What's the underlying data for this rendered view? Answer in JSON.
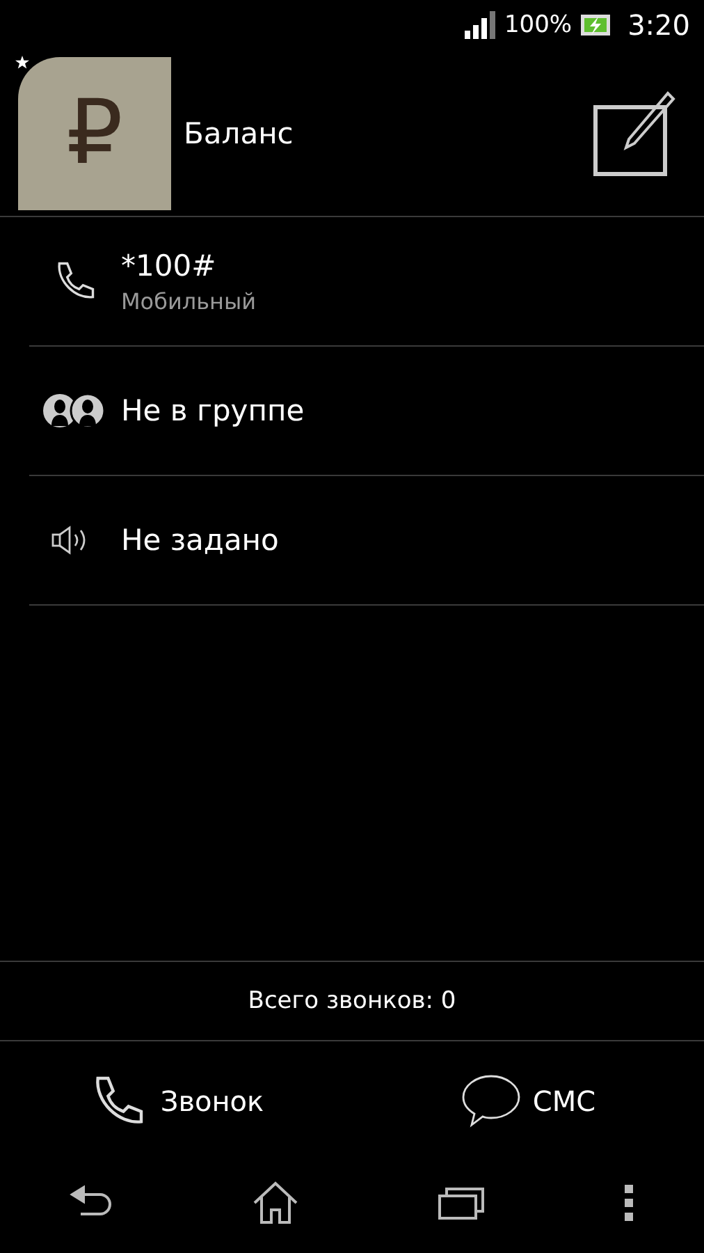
{
  "status_bar": {
    "battery": "100%",
    "time": "3:20"
  },
  "contact": {
    "avatar_symbol": "₽",
    "favorite": true,
    "name": "Баланс"
  },
  "details": [
    {
      "kind": "phone",
      "primary": "*100#",
      "secondary": "Мобильный"
    },
    {
      "kind": "group",
      "primary": "Не в группе"
    },
    {
      "kind": "ringtone",
      "primary": "Не задано"
    }
  ],
  "call_count": "Всего звонков: 0",
  "actions": [
    {
      "kind": "call",
      "label": "Звонок"
    },
    {
      "kind": "sms",
      "label": "СМС"
    }
  ]
}
